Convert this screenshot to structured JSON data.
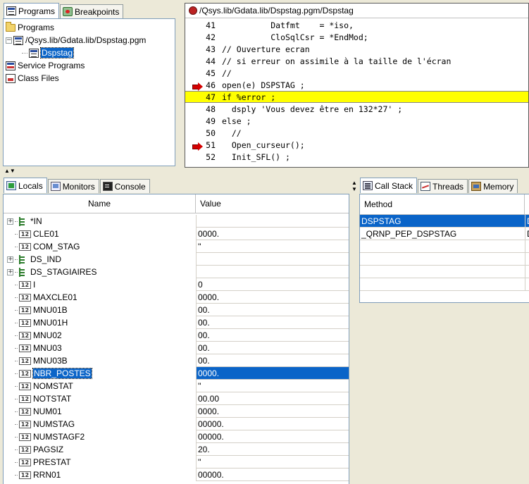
{
  "top_left": {
    "tabs": [
      {
        "label": "Programs",
        "icon": "program-icon",
        "active": true
      },
      {
        "label": "Breakpoints",
        "icon": "breakpoint-icon",
        "active": false
      }
    ],
    "tree": [
      {
        "label": "Programs",
        "icon": "folder-icon"
      },
      {
        "label": "/Qsys.lib/Gdata.lib/Dspstag.pgm",
        "icon": "program-icon"
      },
      {
        "label": "Dspstag",
        "icon": "module-icon"
      },
      {
        "label": "Service Programs",
        "icon": "service-program-icon"
      },
      {
        "label": "Class Files",
        "icon": "class-file-icon"
      }
    ]
  },
  "editor": {
    "title": "/Qsys.lib/Gdata.lib/Dspstag.pgm/Dspstag",
    "lines": [
      {
        "num": "41",
        "text": "          Datfmt    = *iso,",
        "breakpoint": false,
        "highlight": false
      },
      {
        "num": "42",
        "text": "          CloSqlCsr = *EndMod;",
        "breakpoint": false,
        "highlight": false
      },
      {
        "num": "43",
        "text": "// Ouverture ecran",
        "breakpoint": false,
        "highlight": false
      },
      {
        "num": "44",
        "text": "// si erreur on assimile à la taille de l'écran",
        "breakpoint": false,
        "highlight": false
      },
      {
        "num": "45",
        "text": "//",
        "breakpoint": false,
        "highlight": false
      },
      {
        "num": "46",
        "text": "open(e) DSPSTAG ;",
        "breakpoint": true,
        "highlight": false
      },
      {
        "num": "47",
        "text": "if %error ;",
        "breakpoint": false,
        "highlight": true
      },
      {
        "num": "48",
        "text": "  dsply 'Vous devez être en 132*27' ;",
        "breakpoint": false,
        "highlight": false
      },
      {
        "num": "49",
        "text": "else ;",
        "breakpoint": false,
        "highlight": false
      },
      {
        "num": "50",
        "text": "  //",
        "breakpoint": false,
        "highlight": false
      },
      {
        "num": "51",
        "text": "  Open_curseur();",
        "breakpoint": true,
        "highlight": false
      },
      {
        "num": "52",
        "text": "  Init_SFL() ;",
        "breakpoint": false,
        "highlight": false
      }
    ]
  },
  "bottom_left": {
    "tabs": [
      {
        "label": "Locals",
        "icon": "locals-icon",
        "active": true
      },
      {
        "label": "Monitors",
        "icon": "monitors-icon",
        "active": false
      },
      {
        "label": "Console",
        "icon": "console-icon",
        "active": false
      }
    ],
    "columns": {
      "name": "Name",
      "value": "Value"
    },
    "variables": [
      {
        "name": "*IN",
        "type": "struct",
        "expandable": true,
        "value": ""
      },
      {
        "name": "CLE01",
        "type": "12",
        "expandable": false,
        "value": "0000."
      },
      {
        "name": "COM_STAG",
        "type": "12",
        "expandable": false,
        "value": "''"
      },
      {
        "name": "DS_IND",
        "type": "struct",
        "expandable": true,
        "value": ""
      },
      {
        "name": "DS_STAGIAIRES",
        "type": "struct",
        "expandable": true,
        "value": ""
      },
      {
        "name": "I",
        "type": "12",
        "expandable": false,
        "value": "0"
      },
      {
        "name": "MAXCLE01",
        "type": "12",
        "expandable": false,
        "value": "0000."
      },
      {
        "name": "MNU01B",
        "type": "12",
        "expandable": false,
        "value": "00."
      },
      {
        "name": "MNU01H",
        "type": "12",
        "expandable": false,
        "value": "00."
      },
      {
        "name": "MNU02",
        "type": "12",
        "expandable": false,
        "value": "00."
      },
      {
        "name": "MNU03",
        "type": "12",
        "expandable": false,
        "value": "00."
      },
      {
        "name": "MNU03B",
        "type": "12",
        "expandable": false,
        "value": "00."
      },
      {
        "name": "NBR_POSTES",
        "type": "12",
        "expandable": false,
        "value": "0000.",
        "selected": true
      },
      {
        "name": "NOMSTAT",
        "type": "12",
        "expandable": false,
        "value": "''"
      },
      {
        "name": "NOTSTAT",
        "type": "12",
        "expandable": false,
        "value": "00.00"
      },
      {
        "name": "NUM01",
        "type": "12",
        "expandable": false,
        "value": "0000."
      },
      {
        "name": "NUMSTAG",
        "type": "12",
        "expandable": false,
        "value": "00000."
      },
      {
        "name": "NUMSTAGF2",
        "type": "12",
        "expandable": false,
        "value": "00000."
      },
      {
        "name": "PAGSIZ",
        "type": "12",
        "expandable": false,
        "value": "20."
      },
      {
        "name": "PRESTAT",
        "type": "12",
        "expandable": false,
        "value": "''"
      },
      {
        "name": "RRN01",
        "type": "12",
        "expandable": false,
        "value": "00000."
      }
    ]
  },
  "bottom_right": {
    "tabs": [
      {
        "label": "Call Stack",
        "icon": "call-stack-icon",
        "active": true
      },
      {
        "label": "Threads",
        "icon": "threads-icon",
        "active": false
      },
      {
        "label": "Memory",
        "icon": "memory-icon",
        "active": false
      }
    ],
    "columns": {
      "method": "Method"
    },
    "rows": [
      {
        "method": "DSPSTAG",
        "extra": "D",
        "selected": true
      },
      {
        "method": "_QRNP_PEP_DSPSTAG",
        "extra": "D",
        "selected": false
      }
    ]
  },
  "colors": {
    "selection": "#0a64c8",
    "current_line": "#ffff00",
    "breakpoint_arrow": "#d40000"
  }
}
